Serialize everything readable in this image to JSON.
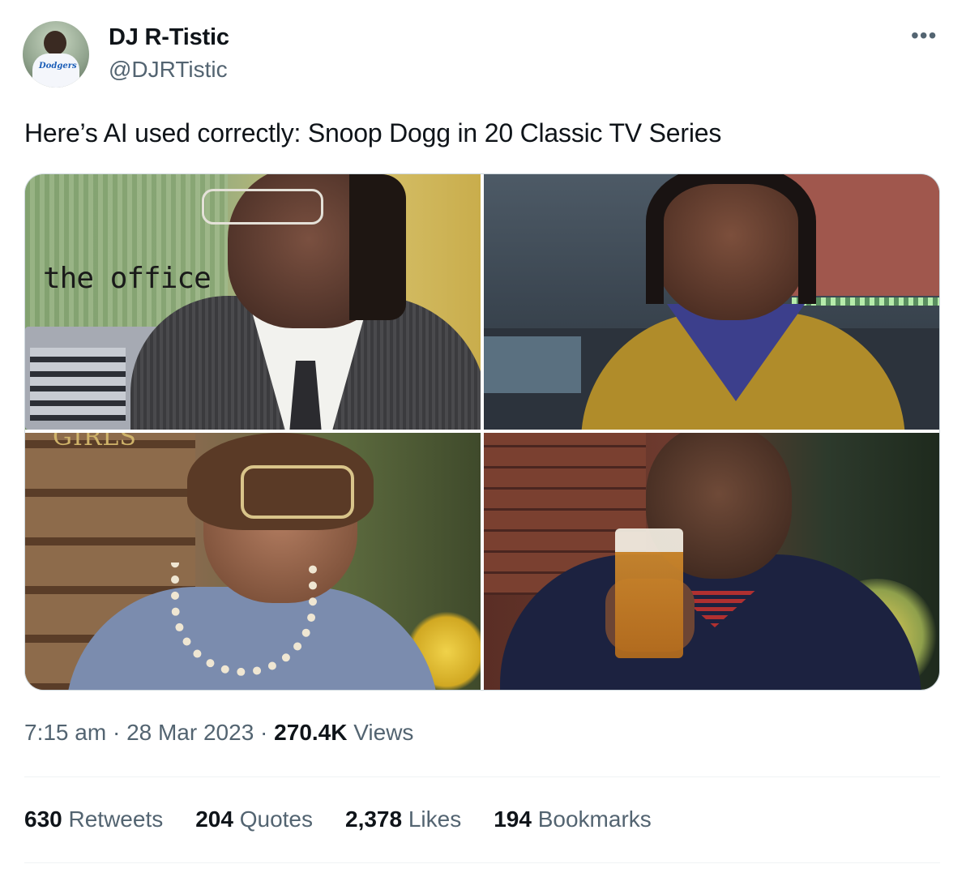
{
  "author": {
    "name": "DJ R-Tistic",
    "handle": "@DJRTistic",
    "avatar_logo": "Dodgers"
  },
  "menu": {
    "more_label": "•••"
  },
  "tweet": {
    "text": "Here’s AI used correctly: Snoop Dogg in 20 Classic TV Series"
  },
  "media": {
    "images": [
      {
        "caption": "the office"
      },
      {
        "caption": ""
      },
      {
        "caption": "GIRLS"
      },
      {
        "caption": ""
      }
    ]
  },
  "meta": {
    "time": "7:15 am",
    "sep1": " · ",
    "date": "28 Mar 2023",
    "sep2": " · ",
    "views_count": "270.4K",
    "views_label": " Views"
  },
  "stats": [
    {
      "count": "630",
      "label": "Retweets"
    },
    {
      "count": "204",
      "label": "Quotes"
    },
    {
      "count": "2,378",
      "label": "Likes"
    },
    {
      "count": "194",
      "label": "Bookmarks"
    }
  ]
}
